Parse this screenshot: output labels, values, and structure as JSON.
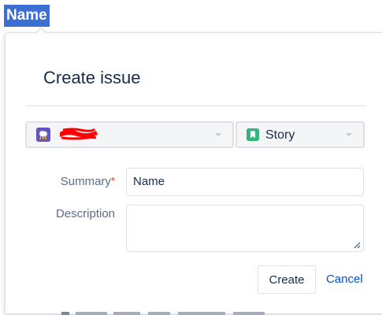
{
  "selection": {
    "text": "Name"
  },
  "dialog": {
    "title": "Create issue",
    "project": {
      "name": "",
      "icon": "project-avatar-icon",
      "redacted": true
    },
    "issue_type": {
      "label": "Story",
      "icon": "story-icon"
    },
    "fields": {
      "summary": {
        "label": "Summary",
        "required_marker": "*",
        "value": "Name"
      },
      "description": {
        "label": "Description",
        "value": ""
      }
    },
    "buttons": {
      "create": "Create",
      "cancel": "Cancel"
    }
  },
  "colors": {
    "selection_bg": "#3b6fd1",
    "project_icon": "#6554c0",
    "story_icon": "#36b37e",
    "link": "#0052cc",
    "required": "#de350b",
    "redaction": "#ff0000"
  }
}
